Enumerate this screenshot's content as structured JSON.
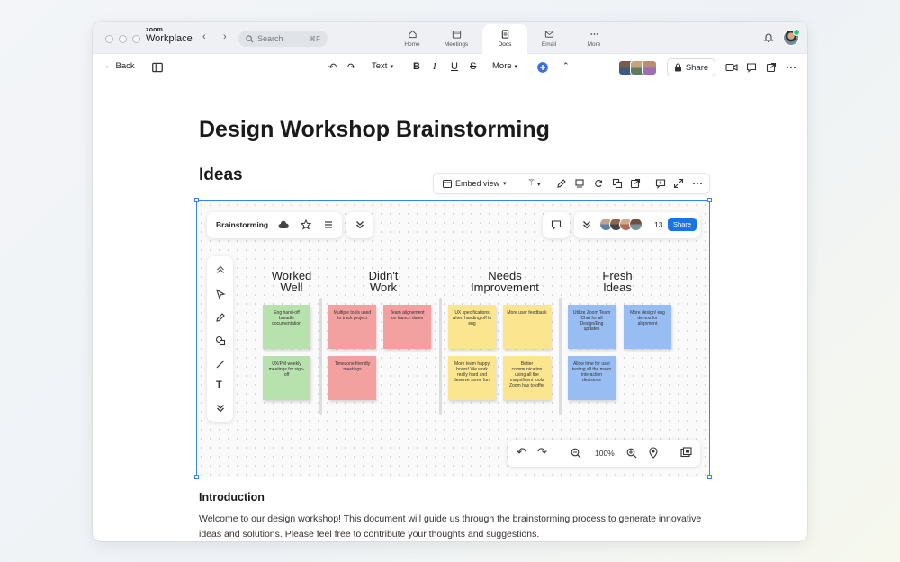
{
  "titlebar": {
    "brand_small": "zoom",
    "brand_big": "Workplace",
    "search_placeholder": "Search",
    "search_shortcut": "⌘F",
    "tabs": [
      {
        "label": "Home",
        "icon": "home-icon"
      },
      {
        "label": "Meetings",
        "icon": "calendar-icon"
      },
      {
        "label": "Docs",
        "icon": "docs-icon",
        "active": true
      },
      {
        "label": "Email",
        "icon": "email-icon"
      },
      {
        "label": "More",
        "icon": "more-icon"
      }
    ]
  },
  "toolbar": {
    "back_label": "Back",
    "text_style_label": "Text",
    "more_label": "More",
    "share_label": "Share"
  },
  "document": {
    "title": "Design Workshop Brainstorming",
    "section_heading": "Ideas",
    "embed_view_label": "Embed view",
    "intro_heading": "Introduction",
    "intro_text": "Welcome to our design workshop! This document will guide us through the brainstorming process to generate innovative ideas and solutions. Please feel free to contribute your thoughts and suggestions."
  },
  "whiteboard": {
    "name": "Brainstorming",
    "participant_count": "13",
    "share_label": "Share",
    "zoom_level": "100%",
    "columns": [
      {
        "title_line1": "Worked",
        "title_line2": "Well"
      },
      {
        "title_line1": "Didn't",
        "title_line2": "Work"
      },
      {
        "title_line1": "Needs",
        "title_line2": "Improvement"
      },
      {
        "title_line1": "Fresh",
        "title_line2": "Ideas"
      }
    ],
    "stickies": [
      {
        "text": "Eng hand-off breadle documentation",
        "color": "green"
      },
      {
        "text": "UX/PM weekly meetings for sign-off",
        "color": "green"
      },
      {
        "text": "Multiple tools used to track project",
        "color": "red"
      },
      {
        "text": "Team alignement on launch dates",
        "color": "red"
      },
      {
        "text": "Timezone friendly meetings",
        "color": "red"
      },
      {
        "text": "UX specifications when handing off to eng",
        "color": "yellow"
      },
      {
        "text": "More user feedback",
        "color": "yellow"
      },
      {
        "text": "More team happy hours! We work really hard and deserve some fun!",
        "color": "yellow"
      },
      {
        "text": "Better communication using all the magnificent tools Zoom has to offer",
        "color": "yellow"
      },
      {
        "text": "Utilize Zoom Team Chat for all Design/Eng updates",
        "color": "blue"
      },
      {
        "text": "More design/ eng demos for alignment",
        "color": "blue"
      },
      {
        "text": "Allow time for user testing all the major interaction decisions",
        "color": "blue"
      }
    ]
  },
  "colors": {
    "accent": "#3b82f6",
    "share_button": "#1a73e8",
    "sticky_green": "#b7e1ad",
    "sticky_red": "#f3a0a0",
    "sticky_yellow": "#fbe58e",
    "sticky_blue": "#98bdf3"
  }
}
